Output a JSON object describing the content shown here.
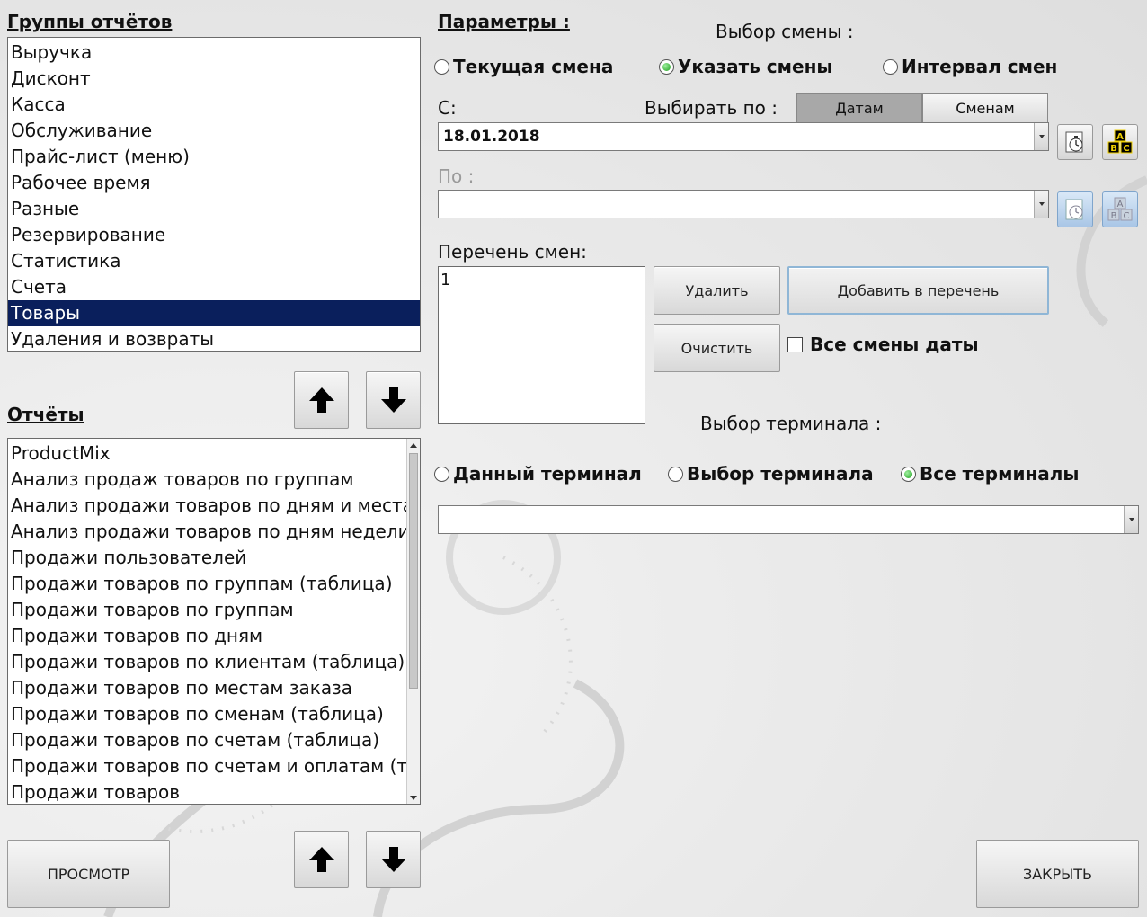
{
  "report_groups": {
    "title": "Группы отчётов",
    "items": [
      "Выручка",
      "Дисконт",
      "Касса",
      "Обслуживание",
      "Прайс-лист (меню)",
      "Рабочее время",
      "Разные",
      "Резервирование",
      "Статистика",
      "Счета",
      "Товары",
      "Удаления и возвраты"
    ],
    "selected": "Товары"
  },
  "reports": {
    "title": "Отчёты",
    "items": [
      "ProductMix",
      "Анализ продаж товаров по группам",
      "Анализ продажи товаров по дням и местам",
      "Анализ продажи товаров по дням недели",
      "Продажи пользователей",
      "Продажи товаров по группам (таблица)",
      "Продажи товаров по группам",
      "Продажи товаров по дням",
      "Продажи товаров по клиентам (таблица)",
      "Продажи товаров по местам заказа",
      "Продажи товаров по сменам (таблица)",
      "Продажи товаров по счетам (таблица)",
      "Продажи товаров по счетам и оплатам (таб",
      "Продажи товаров"
    ]
  },
  "params": {
    "title": "Параметры :",
    "shift_choice_label": "Выбор смены :",
    "shift_radios": [
      {
        "label": "Текущая смена",
        "checked": false
      },
      {
        "label": "Указать смены",
        "checked": true
      },
      {
        "label": "Интервал смен",
        "checked": false
      }
    ],
    "from_label": "С:",
    "select_by_label": "Выбирать по :",
    "select_by_options": [
      "Датам",
      "Сменам"
    ],
    "select_by_active": "Датам",
    "from_value": "18.01.2018",
    "to_label": "По :",
    "to_value": "",
    "shift_list_label": "Перечень смен:",
    "shift_list": [
      "1"
    ],
    "delete_button": "Удалить",
    "add_button": "Добавить в перечень",
    "clear_button": "Очистить",
    "all_shifts_checkbox": "Все смены даты",
    "terminal_choice_label": "Выбор терминала :",
    "terminal_radios": [
      {
        "label": "Данный терминал",
        "checked": false
      },
      {
        "label": "Выбор терминала",
        "checked": false
      },
      {
        "label": "Все терминалы",
        "checked": true
      }
    ],
    "terminal_value": ""
  },
  "footer": {
    "preview_button": "ПРОСМОТР",
    "close_button": "ЗАКРЫТЬ"
  },
  "colors": {
    "selection": "#0a1f5c",
    "radio_on": "#1c9e1c",
    "segment_active": "#a8a8a8"
  }
}
